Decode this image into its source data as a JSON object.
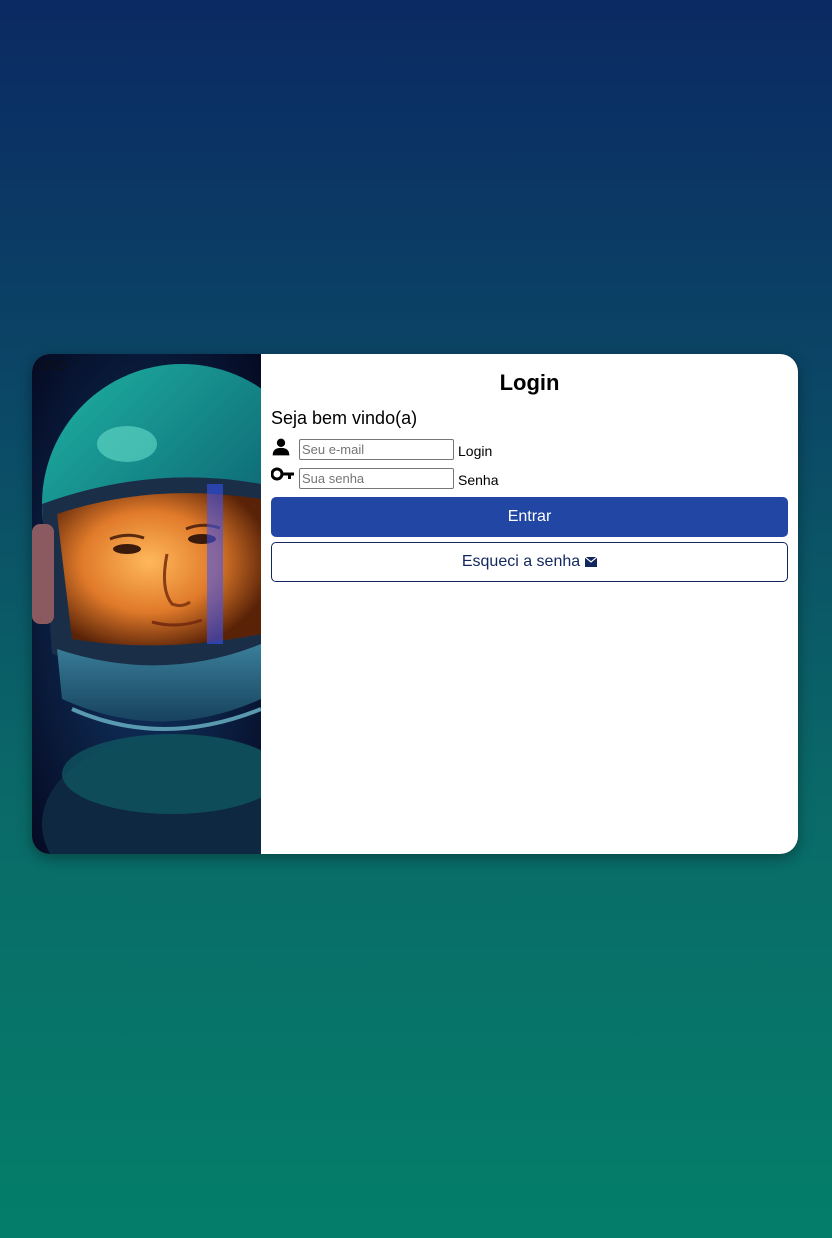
{
  "card": {
    "image_alt": "OTO",
    "title": "Login",
    "welcome": "Seja bem vindo(a)",
    "email": {
      "icon": "person-icon",
      "placeholder": "Seu e-mail",
      "value": "",
      "label": "Login"
    },
    "password": {
      "icon": "key-icon",
      "placeholder": "Sua senha",
      "value": "",
      "label": "Senha"
    },
    "submit_label": "Entrar",
    "forgot_label": "Esqueci a senha",
    "forgot_icon": "mail-icon"
  },
  "colors": {
    "background_top": "#0b2963",
    "background_bottom": "#047e6a",
    "primary_button": "#2146a3",
    "outline_button": "#12275e"
  }
}
